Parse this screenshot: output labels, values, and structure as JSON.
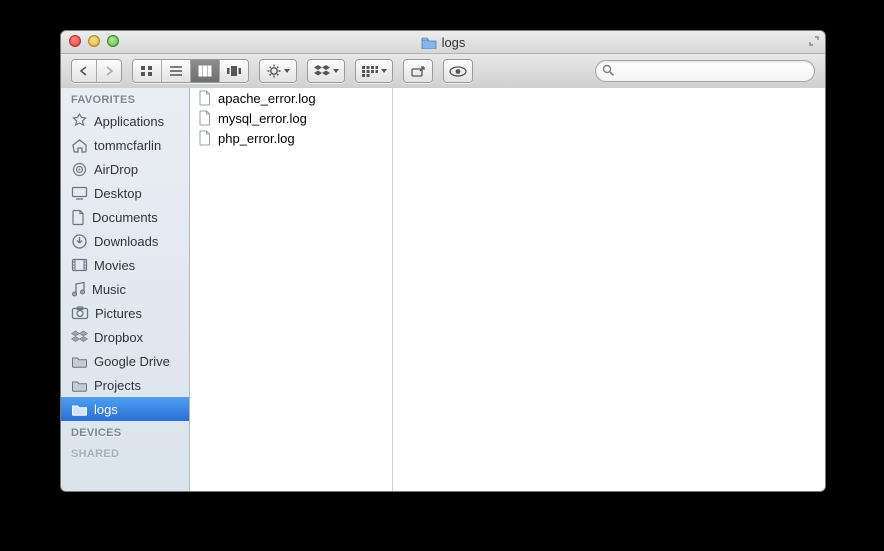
{
  "window": {
    "title": "logs"
  },
  "sidebar": {
    "sections": [
      {
        "header": "FAVORITES"
      },
      {
        "header": "DEVICES"
      },
      {
        "header": "SHARED"
      }
    ],
    "favorites": [
      {
        "label": "Applications",
        "icon": "applications"
      },
      {
        "label": "tommcfarlin",
        "icon": "home"
      },
      {
        "label": "AirDrop",
        "icon": "airdrop"
      },
      {
        "label": "Desktop",
        "icon": "desktop"
      },
      {
        "label": "Documents",
        "icon": "documents"
      },
      {
        "label": "Downloads",
        "icon": "downloads"
      },
      {
        "label": "Movies",
        "icon": "movies"
      },
      {
        "label": "Music",
        "icon": "music"
      },
      {
        "label": "Pictures",
        "icon": "pictures"
      },
      {
        "label": "Dropbox",
        "icon": "dropbox"
      },
      {
        "label": "Google Drive",
        "icon": "folder"
      },
      {
        "label": "Projects",
        "icon": "folder"
      },
      {
        "label": "logs",
        "icon": "folder",
        "selected": true
      }
    ]
  },
  "files": [
    {
      "name": "apache_error.log"
    },
    {
      "name": "mysql_error.log"
    },
    {
      "name": "php_error.log"
    }
  ],
  "search": {
    "value": "",
    "placeholder": ""
  }
}
